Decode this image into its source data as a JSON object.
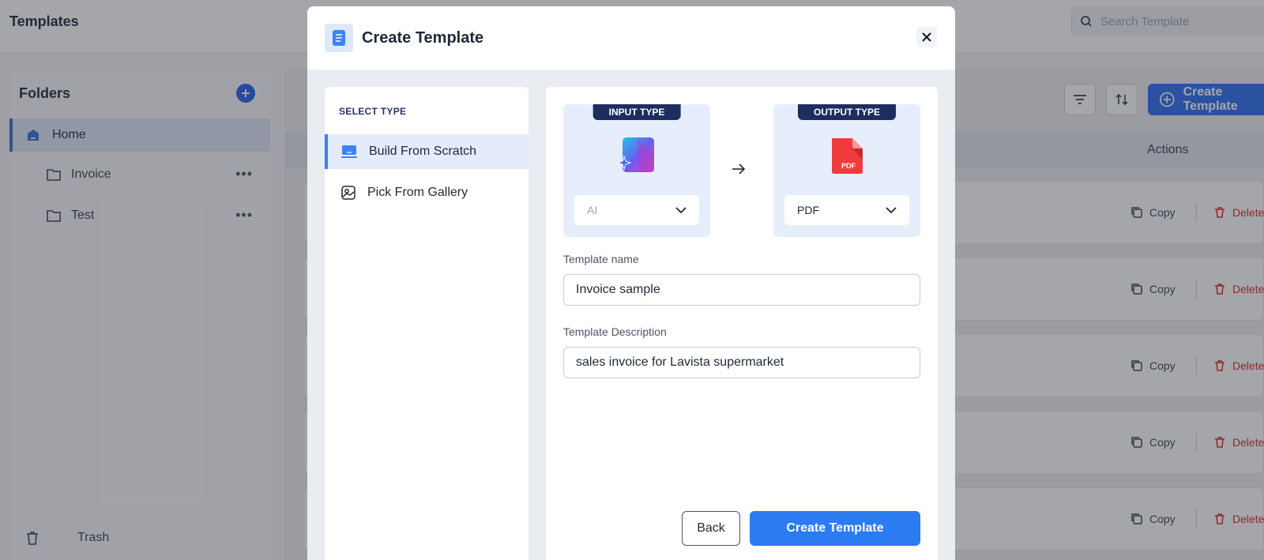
{
  "app": {
    "title": "Templates",
    "search_placeholder": "Search Template"
  },
  "sidebar": {
    "title": "Folders",
    "items": [
      {
        "label": "Home",
        "active": true
      },
      {
        "label": "Invoice"
      },
      {
        "label": "Test"
      }
    ],
    "trash_label": "Trash"
  },
  "toolbar": {
    "create_label": "Create Template"
  },
  "table": {
    "actions_header": "Actions",
    "copy_label": "Copy",
    "delete_label": "Delete"
  },
  "modal": {
    "title": "Create Template",
    "select_type_heading": "SELECT TYPE",
    "types": [
      {
        "label": "Build From Scratch",
        "active": true
      },
      {
        "label": "Pick From Gallery"
      }
    ],
    "input_type": {
      "badge": "INPUT TYPE",
      "value": "AI"
    },
    "output_type": {
      "badge": "OUTPUT TYPE",
      "value": "PDF",
      "icon_text": "PDF"
    },
    "name": {
      "label": "Template name",
      "value": "Invoice sample"
    },
    "description": {
      "label": "Template Description",
      "value": "sales invoice for Lavista supermarket"
    },
    "back_label": "Back",
    "create_label": "Create Template"
  },
  "colors": {
    "accent": "#2b7cf0",
    "badge": "#1d2d5e",
    "delete": "#dc2626"
  }
}
